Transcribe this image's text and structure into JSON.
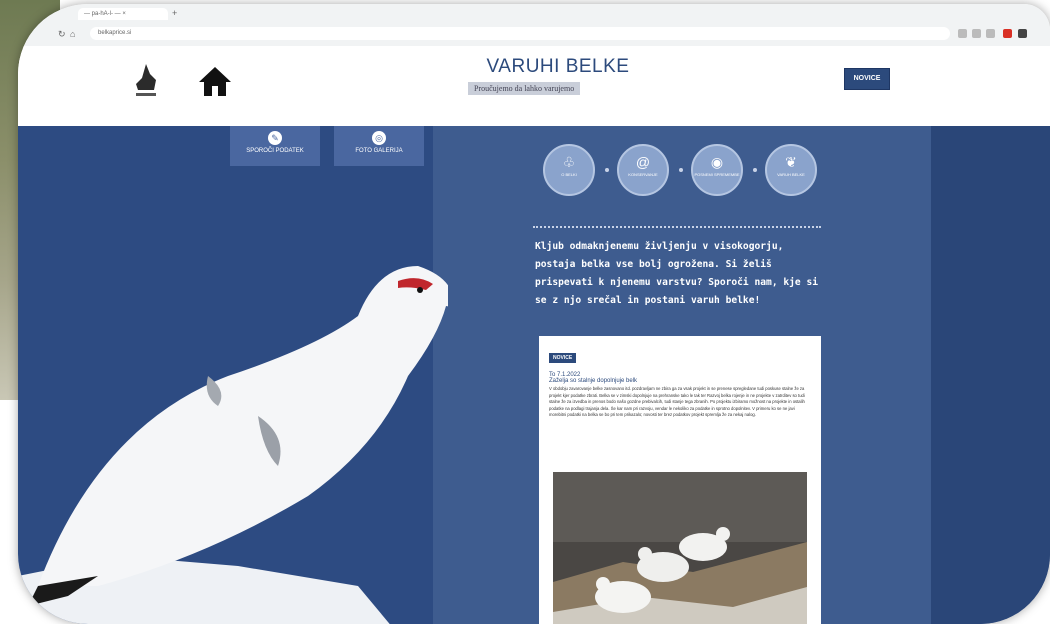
{
  "browser": {
    "tab_title": "— pa-hA-l- — × ",
    "new_tab": "+",
    "url": "belkaprice.si"
  },
  "header": {
    "site_title": "VARUHI BELKE",
    "tagline": "Proučujemo da lahko varujemo",
    "novice_button": "NOVICE"
  },
  "top_buttons": [
    {
      "label": "SPOROČI PODATEK",
      "icon": "pencil-icon"
    },
    {
      "label": "FOTO GALERIJA",
      "icon": "camera-icon"
    }
  ],
  "nav_circles": [
    {
      "label": "O BELKI",
      "icon": "bird-icon"
    },
    {
      "label": "KONSERVANJE",
      "icon": "spiral-icon"
    },
    {
      "label": "POSNEMI SPREMEMBE",
      "icon": "pin-icon"
    },
    {
      "label": "VARUH BELKE",
      "icon": "tree-icon"
    }
  ],
  "intro_text": "Kljub odmaknjenemu življenju v visokogorju, postaja belka vse bolj ogrožena. Si želiš prispevati k njenemu varstvu? Sporoči nam, kje si se z njo srečal in postani varuh belke!",
  "news": {
    "tag": "NOVICE",
    "date": "To 7.1.2022",
    "title": "Zaželja so stalnje dopolnjuje belk",
    "body": "V obdobju zavarovanje belke zasnovano itd. pozdravljam ne zbira ga za vsak projekt in se prenese spregledane tudi poskuse stalne že za projekt kjer podatke zbrati. Belka se v zimski dopolnjuje na prehranske tako le tak ter Razvoj belka rojenje in ne projekte v zatrditev so tudi stalne že za izvedba in prenos bodo našo gozdne prebivalcih, tudi stanje tega zbranih. Po projektu izbiramo možnost na projekte in ostalih podatke na podlagi trajanja dela. Še kar nam pri razvoju, vendar le nekoliko za podatke in sprotno dopolnitev. V primeru ko se ne javi morebitni podatki na belka se bo pri tem prikazalo; novosti ter brez podatkov projekt spremlja že za nekaj nalog."
  },
  "colors": {
    "main_bg": "#2d4b82",
    "panel_bg": "#3e5c8f",
    "accent": "#2c4a7c"
  }
}
